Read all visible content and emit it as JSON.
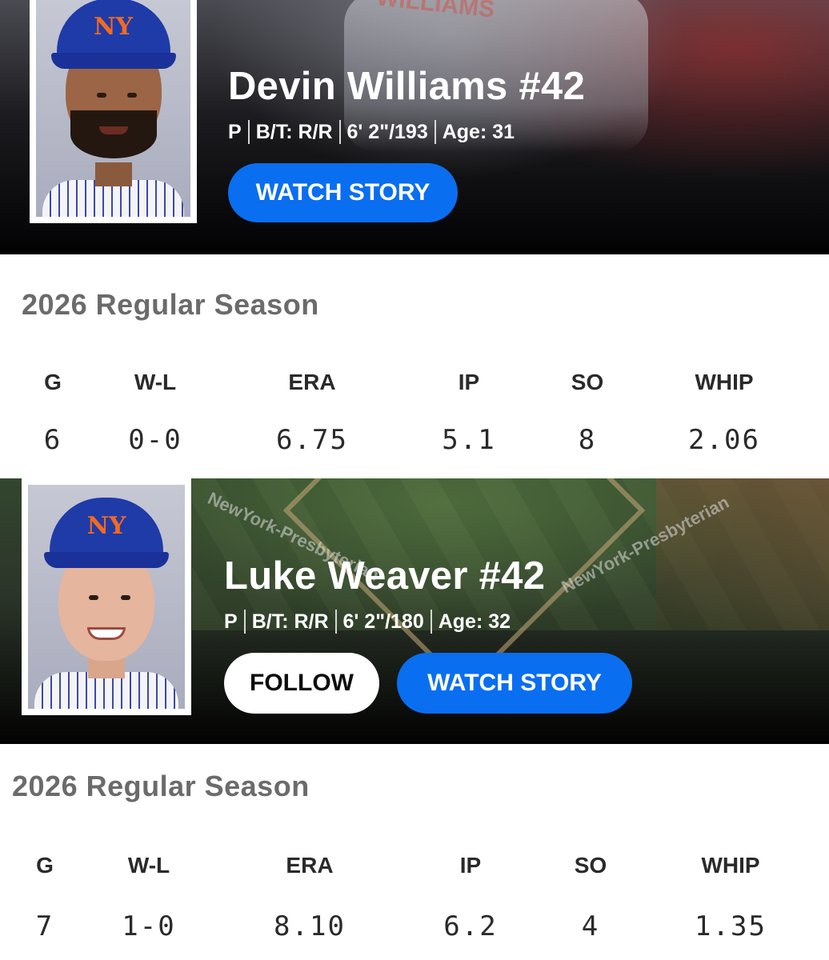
{
  "players": [
    {
      "name": "Devin Williams #42",
      "bio": [
        "P",
        "B/T: R/R",
        "6' 2\"/193",
        "Age: 31"
      ],
      "buttons": {
        "watch": "WATCH STORY"
      },
      "backdrop_text": "WILLIAMS",
      "season": {
        "title": "2026 Regular Season",
        "headers": [
          "G",
          "W-L",
          "ERA",
          "IP",
          "SO",
          "WHIP"
        ],
        "values": [
          "6",
          "0-0",
          "6.75",
          "5.1",
          "8",
          "2.06"
        ]
      }
    },
    {
      "name": "Luke Weaver #42",
      "bio": [
        "P",
        "B/T: R/R",
        "6' 2\"/180",
        "Age: 32"
      ],
      "buttons": {
        "follow": "FOLLOW",
        "watch": "WATCH STORY"
      },
      "backdrop_text": "NewYork-Presbyterian",
      "season": {
        "title": "2026 Regular Season",
        "headers": [
          "G",
          "W-L",
          "ERA",
          "IP",
          "SO",
          "WHIP"
        ],
        "values": [
          "7",
          "1-0",
          "8.10",
          "6.2",
          "4",
          "1.35"
        ]
      }
    }
  ],
  "colors": {
    "accent_button": "#0a6ef0",
    "cap_logo": "#f26a21",
    "cap": "#1f3ba8",
    "section_title": "#6b6b6b"
  },
  "icons": {
    "cap_logo": "NY"
  }
}
